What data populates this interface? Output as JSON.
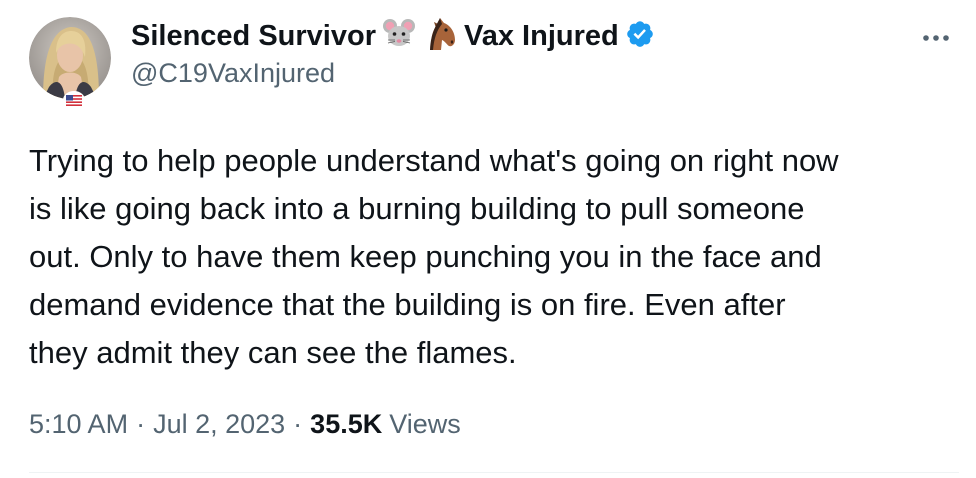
{
  "author": {
    "display_name": "Silenced Survivor",
    "name_suffix": "Vax Injured",
    "handle": "@C19VaxInjured",
    "emojis": [
      "mouse-face-icon",
      "horse-face-icon"
    ],
    "verified_icon": "verified-badge-icon",
    "avatar_icon": "avatar-photo",
    "flag_icon": "us-flag-icon"
  },
  "tweet": {
    "lines": [
      "Trying to help people understand what's going on right now",
      "is like going back into a burning building to pull someone",
      "out. Only to have them keep punching you in the face and",
      "demand evidence that the building is on fire. Even after",
      "they admit they can see the flames."
    ]
  },
  "meta": {
    "time": "5:10 AM",
    "separator": "·",
    "date": "Jul 2, 2023",
    "views_count": "35.5K",
    "views_label": "Views"
  },
  "colors": {
    "text": "#0f1419",
    "secondary": "#536471",
    "verified": "#1d9bf0",
    "divider": "#eff3f4"
  },
  "more_icon": "more-horizontal-icon"
}
